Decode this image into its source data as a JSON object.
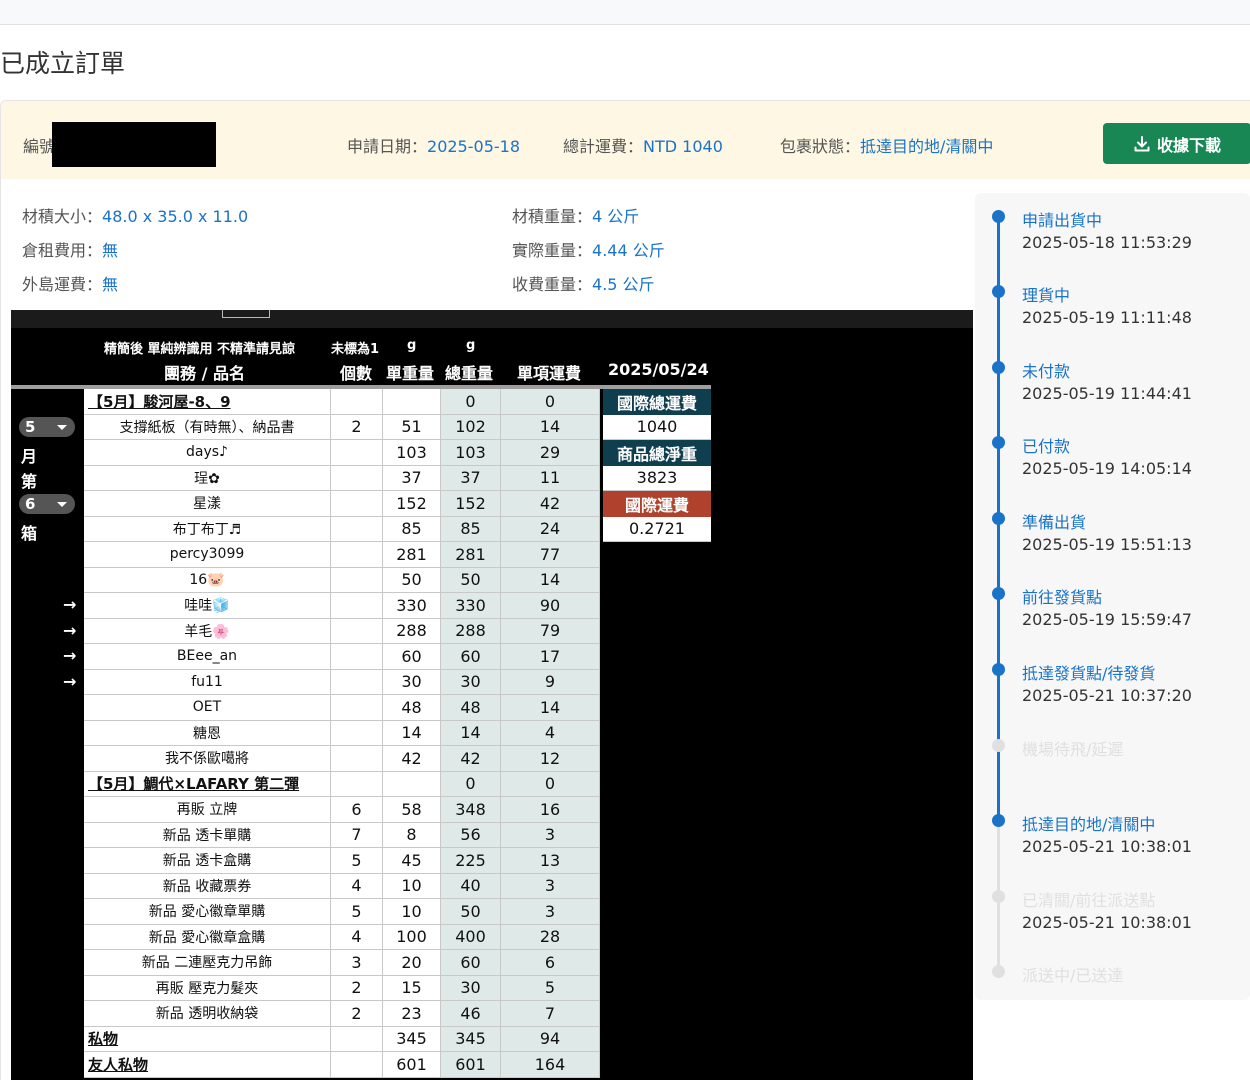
{
  "page": {
    "title": "已成立訂單"
  },
  "order": {
    "id_label": "編號",
    "apply_date_label": "申請日期：",
    "apply_date": "2025-05-18",
    "total_fee_label": "總計運費：",
    "total_fee": "NTD 1040",
    "status_label": "包裹狀態：",
    "status": "抵達目的地/清關中",
    "download_label": "收據下載"
  },
  "details": {
    "volume_label": "材積大小：",
    "volume": "48.0 x 35.0 x 11.0",
    "storage_label": "倉租費用：",
    "storage": "無",
    "island_label": "外島運費：",
    "island": "無",
    "vol_weight_label": "材積重量：",
    "vol_weight": "4 公斤",
    "actual_weight_label": "實際重量：",
    "actual_weight": "4.44 公斤",
    "charge_weight_label": "收費重量：",
    "charge_weight": "4.5 公斤"
  },
  "timeline": [
    {
      "label": "申請出貨中",
      "time": "2025-05-18 11:53:29",
      "active": true
    },
    {
      "label": "理貨中",
      "time": "2025-05-19 11:11:48",
      "active": true
    },
    {
      "label": "未付款",
      "time": "2025-05-19 11:44:41",
      "active": true
    },
    {
      "label": "已付款",
      "time": "2025-05-19 14:05:14",
      "active": true
    },
    {
      "label": "準備出貨",
      "time": "2025-05-19 15:51:13",
      "active": true
    },
    {
      "label": "前往發貨點",
      "time": "2025-05-19 15:59:47",
      "active": true
    },
    {
      "label": "抵達發貨點/待發貨",
      "time": "2025-05-21 10:37:20",
      "active": true
    },
    {
      "label": "機場待飛/延遲",
      "time": "",
      "active": false
    },
    {
      "label": "抵達目的地/清關中",
      "time": "2025-05-21 10:38:01",
      "active": true
    },
    {
      "label": "已清關/前往派送點",
      "time": "2025-05-21 10:38:01",
      "active": false
    },
    {
      "label": "派送中/已送達",
      "time": "",
      "active": false
    }
  ],
  "sheet": {
    "header1": {
      "name": "精簡後 單純辨識用 不精準請見諒",
      "qty": "未標為1",
      "unit": "g",
      "total": "g"
    },
    "header2": {
      "name": "團務 / 品名",
      "qty": "個數",
      "unit": "單重量",
      "total": "總重量",
      "fee": "單項運費",
      "date": "2025/05/24"
    },
    "box": {
      "month": "5",
      "month_char": "月",
      "nth_char": "第",
      "box_no": "6",
      "box_char": "箱"
    },
    "arrow": "→",
    "rows": [
      {
        "name": "【5月】駿河屋-8、9",
        "qty": "",
        "unit": "",
        "total": "0",
        "fee": "0",
        "group": true
      },
      {
        "name": "支撐紙板（有時無）、納品書",
        "qty": "2",
        "unit": "51",
        "total": "102",
        "fee": "14"
      },
      {
        "name": "days♪",
        "qty": "",
        "unit": "103",
        "total": "103",
        "fee": "29"
      },
      {
        "name": "珵✿",
        "qty": "",
        "unit": "37",
        "total": "37",
        "fee": "11"
      },
      {
        "name": "星漾",
        "qty": "",
        "unit": "152",
        "total": "152",
        "fee": "42"
      },
      {
        "name": "布丁布丁♬",
        "qty": "",
        "unit": "85",
        "total": "85",
        "fee": "24"
      },
      {
        "name": "percy3099",
        "qty": "",
        "unit": "281",
        "total": "281",
        "fee": "77"
      },
      {
        "name": "16🐷",
        "qty": "",
        "unit": "50",
        "total": "50",
        "fee": "14"
      },
      {
        "name": "哇哇🧊",
        "qty": "",
        "unit": "330",
        "total": "330",
        "fee": "90",
        "arrow": true
      },
      {
        "name": "羊毛🌸",
        "qty": "",
        "unit": "288",
        "total": "288",
        "fee": "79",
        "arrow": true
      },
      {
        "name": "BEee_an",
        "qty": "",
        "unit": "60",
        "total": "60",
        "fee": "17",
        "arrow": true
      },
      {
        "name": "fu11",
        "qty": "",
        "unit": "30",
        "total": "30",
        "fee": "9",
        "arrow": true
      },
      {
        "name": "OET",
        "qty": "",
        "unit": "48",
        "total": "48",
        "fee": "14"
      },
      {
        "name": "糖恩",
        "qty": "",
        "unit": "14",
        "total": "14",
        "fee": "4"
      },
      {
        "name": "我不係歐噶將",
        "qty": "",
        "unit": "42",
        "total": "42",
        "fee": "12"
      },
      {
        "name": "【5月】鯛代×LAFARY 第二彈",
        "qty": "",
        "unit": "",
        "total": "0",
        "fee": "0",
        "group": true
      },
      {
        "name": "再販 立牌",
        "qty": "6",
        "unit": "58",
        "total": "348",
        "fee": "16"
      },
      {
        "name": "新品 透卡單購",
        "qty": "7",
        "unit": "8",
        "total": "56",
        "fee": "3"
      },
      {
        "name": "新品 透卡盒購",
        "qty": "5",
        "unit": "45",
        "total": "225",
        "fee": "13"
      },
      {
        "name": "新品 收藏票券",
        "qty": "4",
        "unit": "10",
        "total": "40",
        "fee": "3"
      },
      {
        "name": "新品 愛心徽章單購",
        "qty": "5",
        "unit": "10",
        "total": "50",
        "fee": "3"
      },
      {
        "name": "新品 愛心徽章盒購",
        "qty": "4",
        "unit": "100",
        "total": "400",
        "fee": "28"
      },
      {
        "name": "新品 二連壓克力吊飾",
        "qty": "3",
        "unit": "20",
        "total": "60",
        "fee": "6"
      },
      {
        "name": "再販 壓克力髮夾",
        "qty": "2",
        "unit": "15",
        "total": "30",
        "fee": "5"
      },
      {
        "name": "新品 透明收納袋",
        "qty": "2",
        "unit": "23",
        "total": "46",
        "fee": "7"
      },
      {
        "name": "私物",
        "qty": "",
        "unit": "345",
        "total": "345",
        "fee": "94",
        "group": true
      },
      {
        "name": "友人私物",
        "qty": "",
        "unit": "601",
        "total": "601",
        "fee": "164",
        "group": true
      }
    ],
    "summary": [
      {
        "text": "國際總運費",
        "style": "dark"
      },
      {
        "text": "1040",
        "style": "light"
      },
      {
        "text": "商品總淨重",
        "style": "dark"
      },
      {
        "text": "3823",
        "style": "light"
      },
      {
        "text": "國際運費",
        "style": "red"
      },
      {
        "text": "0.2721",
        "style": "light"
      }
    ]
  }
}
